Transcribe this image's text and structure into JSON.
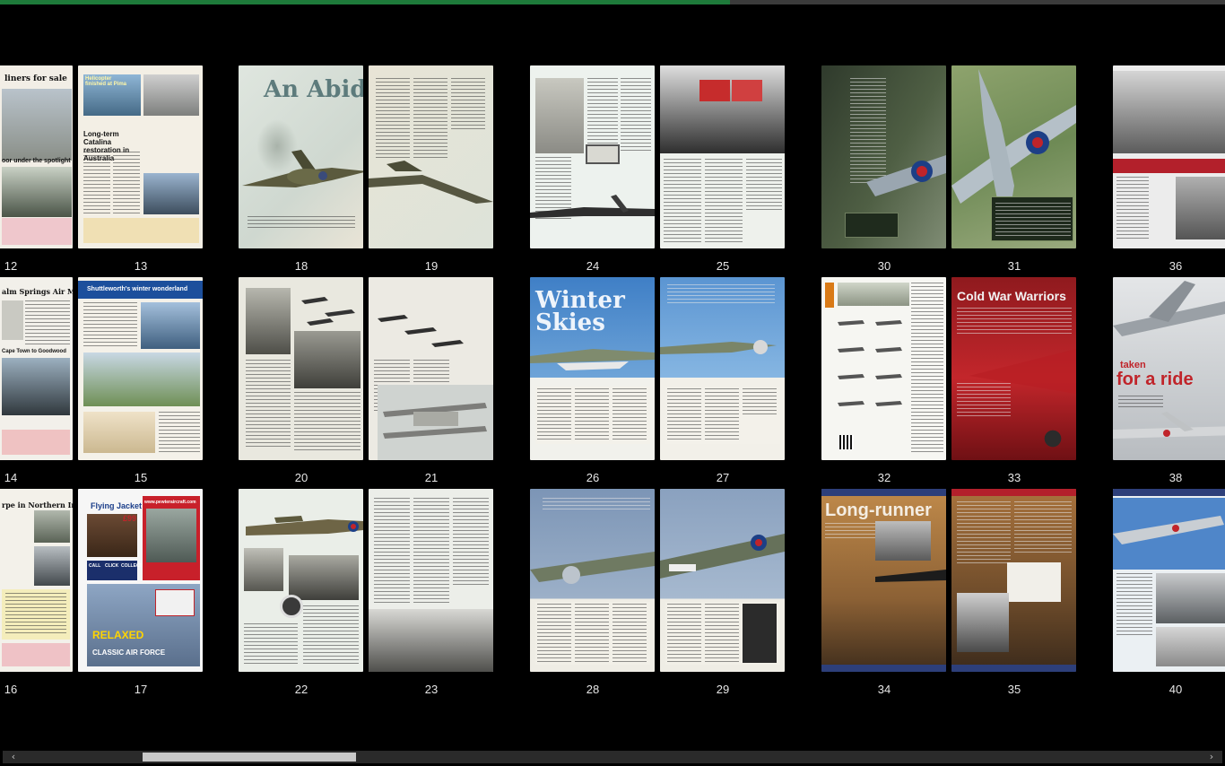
{
  "reader": {
    "progress_fraction": 0.596,
    "scrollbar": {
      "left_arrow": "‹",
      "right_arrow": "›"
    }
  },
  "spreads": [
    {
      "left": {
        "number": "12",
        "headline": "liners for sale",
        "caption": "oor under the spotlight"
      },
      "right": {
        "number": "13",
        "headline": "Helicopter finished at Pima",
        "subhead": "Long-term Catalina restoration in Australia"
      }
    },
    {
      "left": {
        "number": "18",
        "headline": "An Abiding Example"
      },
      "right": {
        "number": "19"
      }
    },
    {
      "left": {
        "number": "24"
      },
      "right": {
        "number": "25"
      }
    },
    {
      "left": {
        "number": "30"
      },
      "right": {
        "number": "31"
      }
    },
    {
      "left": {
        "number": "36"
      },
      "right": null
    },
    {
      "left": {
        "number": "14",
        "headline": "alm Springs Air Museum",
        "caption": "Cape Town to Goodwood"
      },
      "right": {
        "number": "15",
        "headline": "Shuttleworth's winter wonderland"
      }
    },
    {
      "left": {
        "number": "20"
      },
      "right": {
        "number": "21"
      }
    },
    {
      "left": {
        "number": "26",
        "headline": "Winter Skies"
      },
      "right": {
        "number": "27"
      }
    },
    {
      "left": {
        "number": "32"
      },
      "right": {
        "number": "33",
        "headline": "Cold War Warriors"
      }
    },
    {
      "left": {
        "number": "38",
        "headline": "for a ride",
        "kicker": "taken"
      },
      "right": null
    },
    {
      "left": {
        "number": "16",
        "headline": "rpe in Northern Ireland"
      },
      "right": {
        "number": "17",
        "headline": "Flying Jacket",
        "price": "£99",
        "url": "www.pewteraircraft.com",
        "buttons": [
          "CALL",
          "CLICK",
          "COLLECT"
        ],
        "banner": "RELAXED",
        "footer": "CLASSIC AIR FORCE"
      }
    },
    {
      "left": {
        "number": "22"
      },
      "right": {
        "number": "23"
      }
    },
    {
      "left": {
        "number": "28"
      },
      "right": {
        "number": "29"
      }
    },
    {
      "left": {
        "number": "34",
        "headline": "Long-runner"
      },
      "right": {
        "number": "35"
      }
    },
    {
      "left": {
        "number": "40"
      },
      "right": null
    }
  ]
}
